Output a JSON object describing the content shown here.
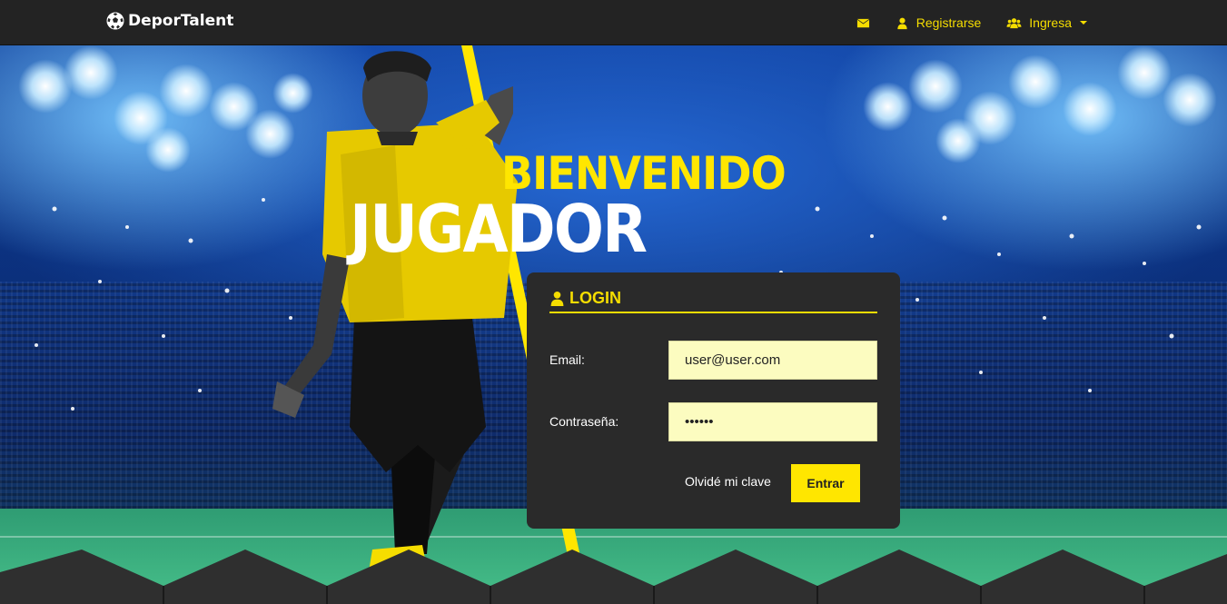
{
  "navbar": {
    "brand": "DeporTalent",
    "register_label": "Registrarse",
    "login_label": "Ingresa"
  },
  "hero": {
    "line1": "BIENVENIDO",
    "line2": "JUGADOR"
  },
  "login": {
    "title": "LOGIN",
    "email_label": "Email:",
    "email_value": "user@user.com",
    "password_label": "Contraseña:",
    "password_value": "123456",
    "forgot_label": "Olvidé mi clave",
    "submit_label": "Entrar"
  },
  "colors": {
    "accent": "#ffe600",
    "nav_bg": "#232323",
    "panel_bg": "#2a2a2a",
    "input_bg": "#fcfcc0"
  },
  "icons": {
    "brand": "soccer-ball-icon",
    "mail": "envelope-icon",
    "register": "user-icon",
    "login": "users-icon",
    "login_title": "user-icon"
  }
}
